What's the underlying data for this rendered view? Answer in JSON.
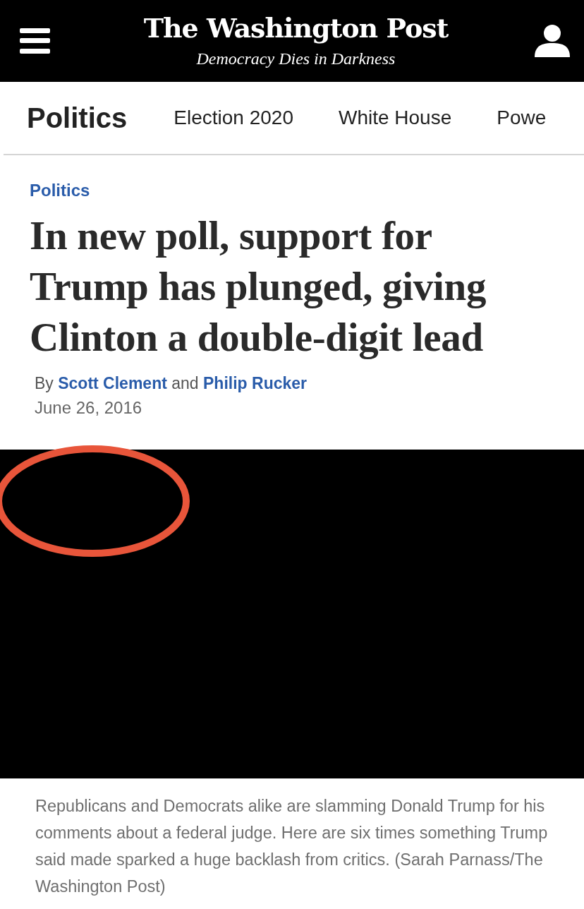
{
  "header": {
    "logo": "The Washington Post",
    "tagline": "Democracy Dies in Darkness"
  },
  "nav": {
    "section": "Politics",
    "items": [
      {
        "label": "Election 2020"
      },
      {
        "label": "White House"
      },
      {
        "label": "Powe"
      }
    ]
  },
  "article": {
    "kicker": "Politics",
    "headline": "In new poll, support for Trump has plunged, giving Clinton a double-digit lead",
    "byline": {
      "prefix": "By",
      "authors": [
        "Scott Clement",
        "Philip Rucker"
      ],
      "joiner": "and"
    },
    "date": "June 26, 2016"
  },
  "video": {
    "caption": "Republicans and Democrats alike are slamming Donald Trump for his comments about a federal judge. Here are six times something Trump said made sparked a huge backlash from critics. (Sarah Parnass/The Washington Post)"
  },
  "annotation": {
    "kind": "ellipse",
    "color": "#e8553a"
  }
}
